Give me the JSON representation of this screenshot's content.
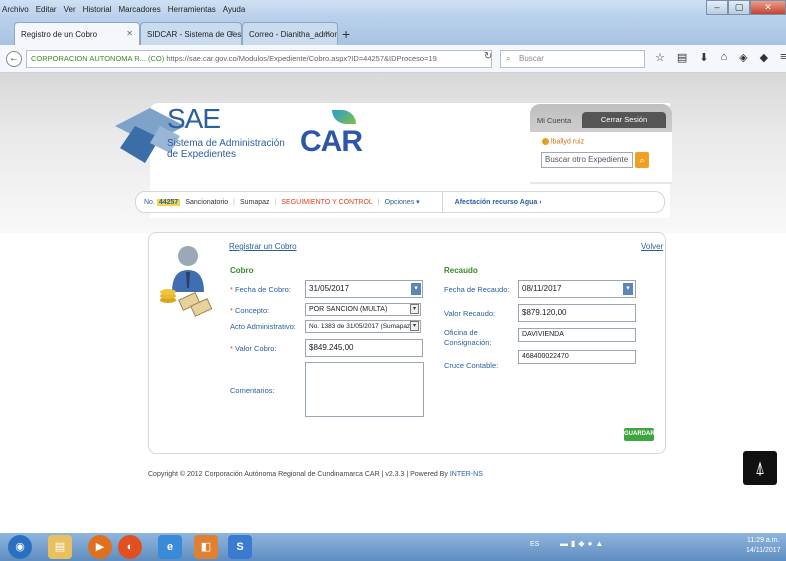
{
  "browser": {
    "menu": [
      "Archivo",
      "Editar",
      "Ver",
      "Historial",
      "Marcadores",
      "Herramientas",
      "Ayuda"
    ],
    "tabs": [
      {
        "label": "Registro de un Cobro"
      },
      {
        "label": "SIDCAR - Sistema de Gestión Do..."
      },
      {
        "label": "Correo - Dianitha_admon@..."
      }
    ],
    "url_org": "CORPORACION AUTONOMA R... (CO)",
    "url_path": "https://sae.car.gov.co/Modulos/Expediente/Cobro.aspx?ID=44257&IDProceso=19",
    "search_placeholder": "Buscar"
  },
  "header": {
    "sae_title": "SAE",
    "sae_sub1": "Sistema de Administración",
    "sae_sub2": "de Expedientes",
    "car_logo": "CAR"
  },
  "account": {
    "mi_cuenta": "Mi Cuenta",
    "cerrar_sesion": "Cerrar Sesión",
    "user": "lballyd ruiz",
    "search_placeholder": "Buscar otro Expediente"
  },
  "breadcrumb": {
    "no_label": "No.",
    "number": "44257",
    "item1": "Sancionatorio",
    "item2": "Sumapaz",
    "status": "SEGUIMIENTO Y CONTROL",
    "options": "Opciones",
    "afectacion": "Afectación recurso Agua"
  },
  "form": {
    "title": "Registrar un Cobro",
    "volver": "Volver",
    "cobro": {
      "section": "Cobro",
      "fecha_label": "Fecha de Cobro:",
      "fecha_value": "31/05/2017",
      "concepto_label": "Concepto:",
      "concepto_value": "POR SANCION (MULTA)",
      "acto_label": "Acto Administrativo:",
      "acto_value": "No. 1383 de 31/05/2017 (Sumapaz)",
      "valor_label": "Valor Cobro:",
      "valor_value": "$849.245,00",
      "comentarios_label": "Comentarios:"
    },
    "recaudo": {
      "section": "Recaudo",
      "fecha_label": "Fecha de Recaudo:",
      "fecha_value": "08/11/2017",
      "valor_label": "Valor Recaudo:",
      "valor_value": "$879.120,00",
      "oficina_label_1": "Oficina de",
      "oficina_label_2": "Consignación:",
      "oficina_value": "DAVIVIENDA",
      "cruce_label": "Cruce Contable:",
      "cruce_value": "468400022470"
    },
    "guardar": "GUARDAR"
  },
  "footer": {
    "text": "Copyright © 2012 Corporación Autónoma Regional de Cundinamarca CAR | v2.3.3 | Powered By",
    "powered": "INTER-NS"
  },
  "taskbar": {
    "lang": "ES",
    "time": "11:29 a.m.",
    "date": "14/11/2017"
  }
}
